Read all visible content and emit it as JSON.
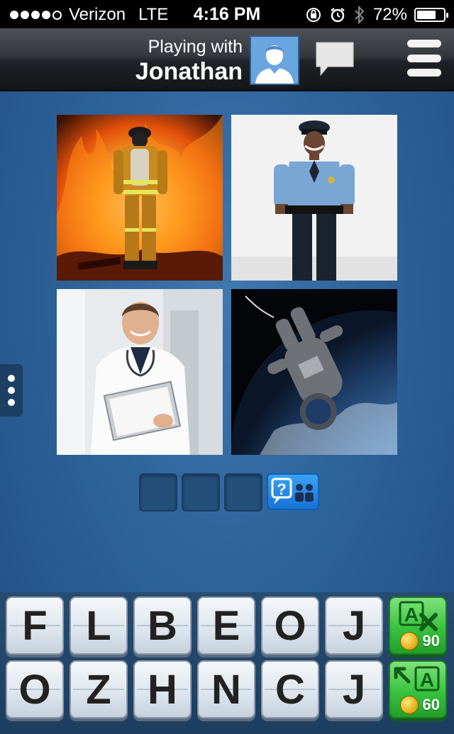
{
  "status_bar": {
    "carrier": "Verizon",
    "network": "LTE",
    "time": "4:16 PM",
    "battery": "72%",
    "battery_level": 0.72,
    "signal_bars": 4
  },
  "header": {
    "playing_with_label": "Playing with",
    "opponent_name": "Jonathan"
  },
  "puzzle": {
    "images": [
      "firefighter",
      "police officer",
      "doctor",
      "astronaut"
    ],
    "answer_length": 3,
    "ask_friends_icon": "question-people-icon"
  },
  "keyboard": {
    "row1": [
      "F",
      "L",
      "B",
      "E",
      "O",
      "J"
    ],
    "row2": [
      "O",
      "Z",
      "H",
      "N",
      "C",
      "J"
    ]
  },
  "powerups": {
    "remove_letters": {
      "label": "A",
      "cost": "90",
      "icon": "remove-letters-icon"
    },
    "reveal_letter": {
      "label": "A",
      "cost": "60",
      "icon": "reveal-letter-icon"
    }
  },
  "colors": {
    "background": "#2e6399",
    "power_green": "#39c23e",
    "ask_blue": "#1f8ce8"
  }
}
